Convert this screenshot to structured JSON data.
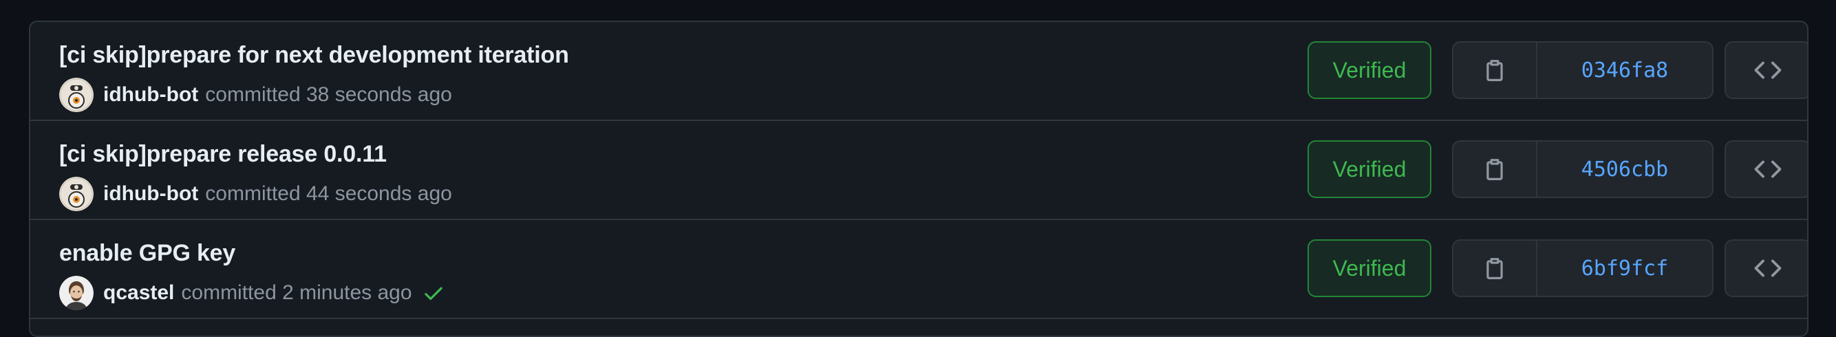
{
  "commits": [
    {
      "title": "[ci skip]prepare for next development iteration",
      "author": "idhub-bot",
      "committed": "committed 38 seconds ago",
      "avatar_icon": "bot-avatar-icon",
      "verified_label": "Verified",
      "sha": "0346fa8",
      "status_check": false
    },
    {
      "title": "[ci skip]prepare release 0.0.11",
      "author": "idhub-bot",
      "committed": "committed 44 seconds ago",
      "avatar_icon": "bot-avatar-icon",
      "verified_label": "Verified",
      "sha": "4506cbb",
      "status_check": false
    },
    {
      "title": "enable GPG key",
      "author": "qcastel",
      "committed": "committed 2 minutes ago",
      "avatar_icon": "user-avatar-icon",
      "verified_label": "Verified",
      "sha": "6bf9fcf",
      "status_check": true
    }
  ],
  "icons": {
    "copy": "clipboard-icon",
    "browse": "code-icon",
    "status": "check-icon"
  },
  "colors": {
    "background": "#0d1117",
    "panel": "#161b22",
    "border": "#30363d",
    "verified": "#3fb950",
    "sha": "#58a6ff",
    "text": "#e6edf3",
    "muted": "#8d96a0"
  }
}
